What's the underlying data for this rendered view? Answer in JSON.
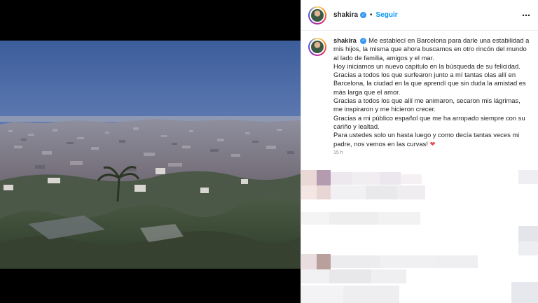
{
  "header": {
    "username": "shakira",
    "follow_label": "Seguir",
    "separator": "•",
    "more_icon": "⋯"
  },
  "caption": {
    "username": "shakira",
    "lines": [
      "Me establecí en Barcelona para darle una estabilidad a mis hijos, la misma que ahora buscamos en otro rincón del mundo al lado de familia, amigos y el mar.",
      "Hoy iniciamos un nuevo capítulo en la búsqueda de su felicidad.",
      "Gracias a todos los que surfearon junto a mí tantas olas allí en Barcelona, la ciudad en la que aprendí que sin duda la amistad es más larga que el amor.",
      "Gracias a todos los que allí me animaron, secaron mis lágrimas, me inspiraron y me hicieron crecer.",
      "Gracias a mi público español que me ha arropado siempre con su cariño y lealtad.",
      "Para ustedes solo un hasta luego y como decía tantas veces mi padre, nos vemos en las curvas!"
    ],
    "heart": "❤",
    "timestamp": "15 h"
  },
  "colors": {
    "follow": "#0095f6",
    "verified": "#3897f0",
    "heart": "#ed4956"
  }
}
